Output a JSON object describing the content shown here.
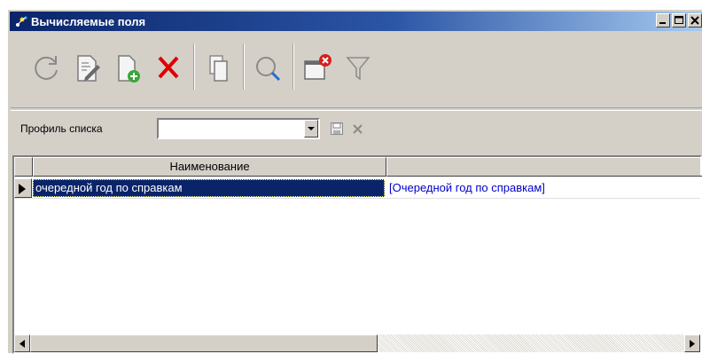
{
  "window": {
    "title": "Вычисляемые поля",
    "controls": [
      "minimize",
      "maximize",
      "close"
    ]
  },
  "toolbar": {
    "buttons": [
      {
        "name": "refresh",
        "icon": "refresh-icon"
      },
      {
        "name": "edit",
        "icon": "edit-document-icon"
      },
      {
        "name": "create",
        "icon": "new-document-icon"
      },
      {
        "name": "delete",
        "icon": "delete-x-icon"
      },
      {
        "name": "copy",
        "icon": "copy-icon"
      },
      {
        "name": "search",
        "icon": "search-icon"
      },
      {
        "name": "close-window",
        "icon": "window-close-icon"
      },
      {
        "name": "filter",
        "icon": "filter-icon"
      }
    ]
  },
  "profile": {
    "label": "Профиль списка",
    "value": ""
  },
  "grid": {
    "columns": [
      "Наименование",
      ""
    ],
    "rows": [
      {
        "name": "очередной год по справкам",
        "expression": "[Очередной год по справкам]",
        "selected": true
      }
    ]
  },
  "colors": {
    "title_start": "#0a246a",
    "title_end": "#a6caf0",
    "selection": "#0a246a",
    "link_text": "#0000cc",
    "delete_red": "#e00000"
  }
}
